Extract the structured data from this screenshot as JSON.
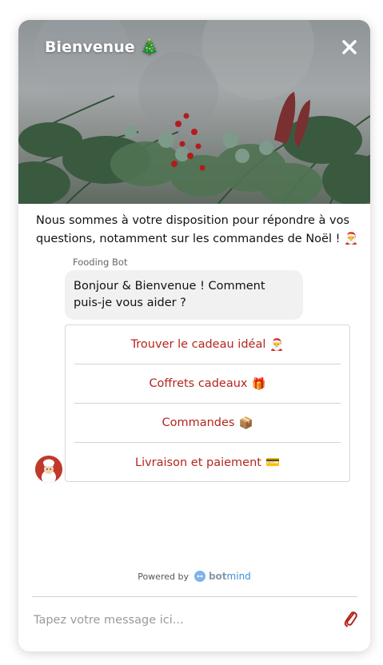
{
  "header": {
    "title": "Bienvenue 🎄",
    "close_icon": "close-icon"
  },
  "intro": {
    "text": "Nous sommes à votre disposition pour répondre à vos questions, notamment sur les commandes de Noël ! 🎅"
  },
  "bot": {
    "name": "Fooding Bot",
    "message": "Bonjour & Bienvenue ! Comment puis-je vous aider ?",
    "avatar_icon": "chef-avatar-icon"
  },
  "choices": [
    {
      "label": "Trouver le cadeau idéal",
      "emoji": "🎅"
    },
    {
      "label": "Coffrets cadeaux",
      "emoji": "🎁"
    },
    {
      "label": "Commandes",
      "emoji": "📦"
    },
    {
      "label": "Livraison et paiement",
      "emoji": "💳"
    }
  ],
  "footer": {
    "powered_by": "Powered by",
    "brand_bot": "bot",
    "brand_mind": "mind"
  },
  "composer": {
    "placeholder": "Tapez votre message ici...",
    "attach_icon": "paperclip-icon"
  },
  "colors": {
    "accent": "#b3261e",
    "bubble_bg": "#f1f1f2",
    "brand_blue": "#3f8fd8"
  }
}
